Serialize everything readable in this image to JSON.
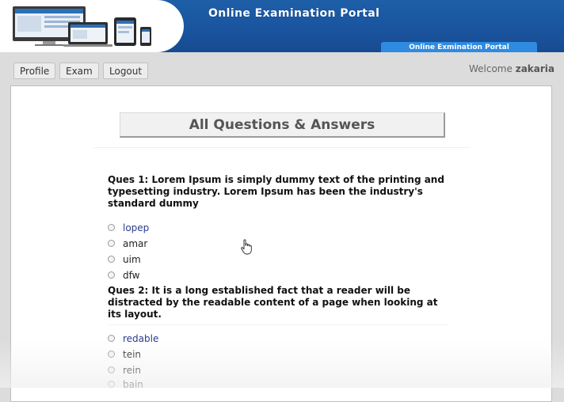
{
  "header": {
    "title": "Online Examination Portal",
    "subtab": "Online Exmination Portal",
    "bg_color": "#1a55a0"
  },
  "nav": {
    "items": [
      "Profile",
      "Exam",
      "Logout"
    ],
    "welcome_prefix": "Welcome",
    "username": "zakaria"
  },
  "main": {
    "title": "All Questions & Answers",
    "questions": [
      {
        "text": "Ques 1: Lorem Ipsum is simply dummy text of the printing and typesetting industry. Lorem Ipsum has been the industry's standard dummy",
        "options": [
          "lopep",
          "amar",
          "uim",
          "dfw"
        ],
        "selected": "lopep"
      },
      {
        "text": "Ques 2: It is a long established fact that a reader will be distracted by the readable content of a page when looking at its layout.",
        "options": [
          "redable",
          "tein",
          "rein",
          "bain"
        ],
        "selected": "redable"
      }
    ]
  },
  "colors": {
    "accent": "#1e5fa8",
    "selected_option": "#2a3a8e"
  }
}
